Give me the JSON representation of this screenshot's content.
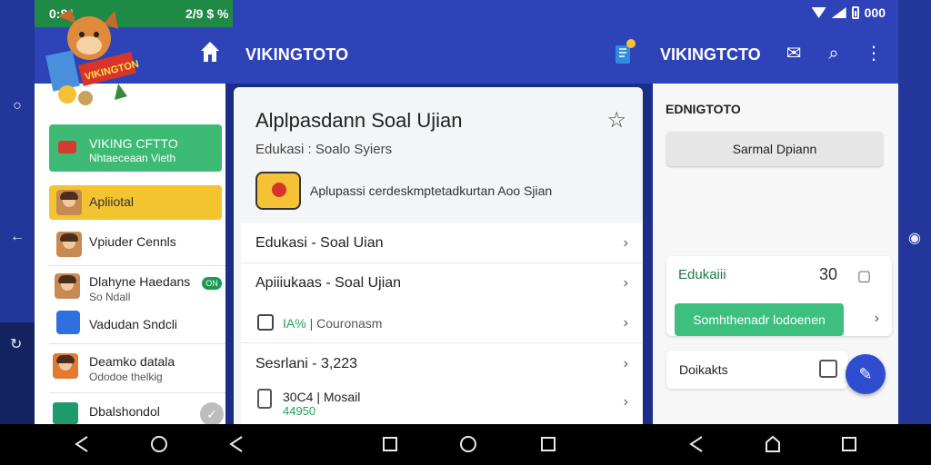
{
  "status": {
    "time": "0:81",
    "center": "2/9 $ %",
    "battery": "000"
  },
  "appbar": {
    "title": "VIKINGTOTO",
    "title_right": "VIKINGTCTO"
  },
  "logo": {
    "banner_text": "VIKINGTON"
  },
  "sidebar": {
    "green_card": {
      "line1": "VIKING CFTTO",
      "line2": "Nhtaeceaan Vieth"
    },
    "yellow_card": {
      "label": "Apliiotal"
    },
    "items": [
      {
        "line1": "Vpiuder Cennls",
        "line2": ""
      },
      {
        "line1": "Dlahyne Haedans",
        "line2": "So Ndall",
        "badge": "ON"
      },
      {
        "line1": "Vadudan Sndcli",
        "line2": ""
      },
      {
        "line1": "Deamko datala",
        "line2": "Ododoe thelkig"
      },
      {
        "line1": "Dbalshondol",
        "line2": ""
      }
    ]
  },
  "main": {
    "title": "Alplpasdann Soal Ujian",
    "subtitle": "Edukasi : Soalo Syiers",
    "promo_text": "Aplupassi cerdeskmptetadkurtan Aoo Sjian",
    "rows": [
      {
        "text": "Edukasi - Soal Uian"
      },
      {
        "text": "Apiiiukaas - Soal Ujian"
      },
      {
        "text_green": "IA%",
        "text": "| Couronasm"
      },
      {
        "text": "Sesrlani - 3,223"
      },
      {
        "text": "30C4 | Mosail",
        "sub_green": "44950"
      }
    ]
  },
  "right": {
    "title": "EDNIGTOTO",
    "button": "Sarmal Dpiann",
    "card": {
      "label": "Edukaiii",
      "count": "30",
      "button": "Somhthenadr lodoenen"
    },
    "input_label": "Doikakts"
  },
  "colors": {
    "appbar": "#2e43b8",
    "status_green": "#1f8a45",
    "accent_green": "#3dbb74",
    "accent_yellow": "#f4c330",
    "fab": "#2f4dd1"
  }
}
